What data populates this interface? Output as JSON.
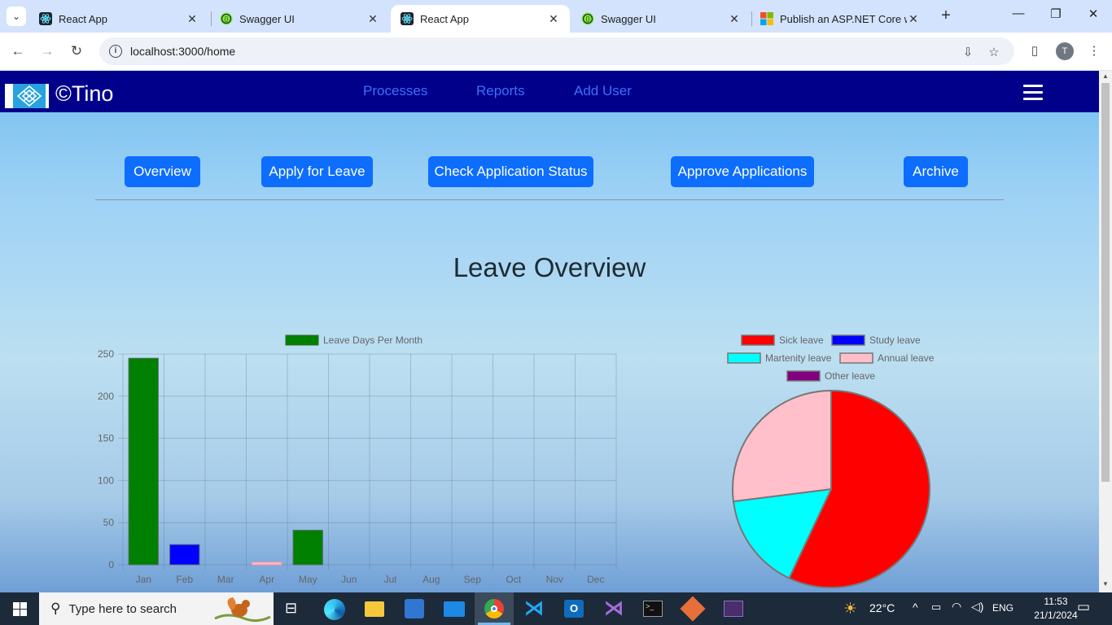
{
  "browser": {
    "tabs": [
      {
        "title": "React App",
        "icon": "react-icon",
        "active": false
      },
      {
        "title": "Swagger UI",
        "icon": "swagger-icon",
        "active": false
      },
      {
        "title": "React App",
        "icon": "react-icon",
        "active": true
      },
      {
        "title": "Swagger UI",
        "icon": "swagger-icon",
        "active": false
      },
      {
        "title": "Publish an ASP.NET Core we",
        "icon": "microsoft-icon",
        "active": false
      }
    ],
    "url": "localhost:3000/home",
    "profile_initial": "T"
  },
  "app": {
    "brand": "©Tino",
    "nav_links": [
      "Processes",
      "Reports",
      "Add User"
    ],
    "actions": [
      "Overview",
      "Apply for Leave",
      "Check Application Status",
      "Approve Applications",
      "Archive"
    ],
    "page_title": "Leave Overview"
  },
  "chart_data": [
    {
      "type": "bar",
      "legend": "Leave Days Per Month",
      "categories": [
        "Jan",
        "Feb",
        "Mar",
        "Apr",
        "May",
        "Jun",
        "Jul",
        "Aug",
        "Sep",
        "Oct",
        "Nov",
        "Dec"
      ],
      "values": [
        245,
        24,
        0,
        3,
        41,
        0,
        0,
        0,
        0,
        0,
        0,
        0
      ],
      "bar_colors": [
        "#008000",
        "#0000ff",
        "#ff0000",
        "#ffc0cb",
        "#008000",
        "#008000",
        "#008000",
        "#008000",
        "#008000",
        "#008000",
        "#008000",
        "#008000"
      ],
      "legend_color": "#008000",
      "ylim": [
        0,
        250
      ],
      "yticks": [
        0,
        50,
        100,
        150,
        200,
        250
      ],
      "grid": true,
      "legend_position": "top"
    },
    {
      "type": "pie",
      "labels": [
        "Sick leave",
        "Study leave",
        "Martenity leave",
        "Annual leave",
        "Other leave"
      ],
      "values": [
        57,
        0,
        16,
        27,
        0
      ],
      "colors": [
        "#ff0000",
        "#0000ff",
        "#00ffff",
        "#ffc0cb",
        "#800080"
      ],
      "legend_position": "top"
    }
  ],
  "taskbar": {
    "search_placeholder": "Type here to search",
    "weather": "22°C",
    "language": "ENG",
    "time": "11:53",
    "date": "21/1/2024"
  }
}
